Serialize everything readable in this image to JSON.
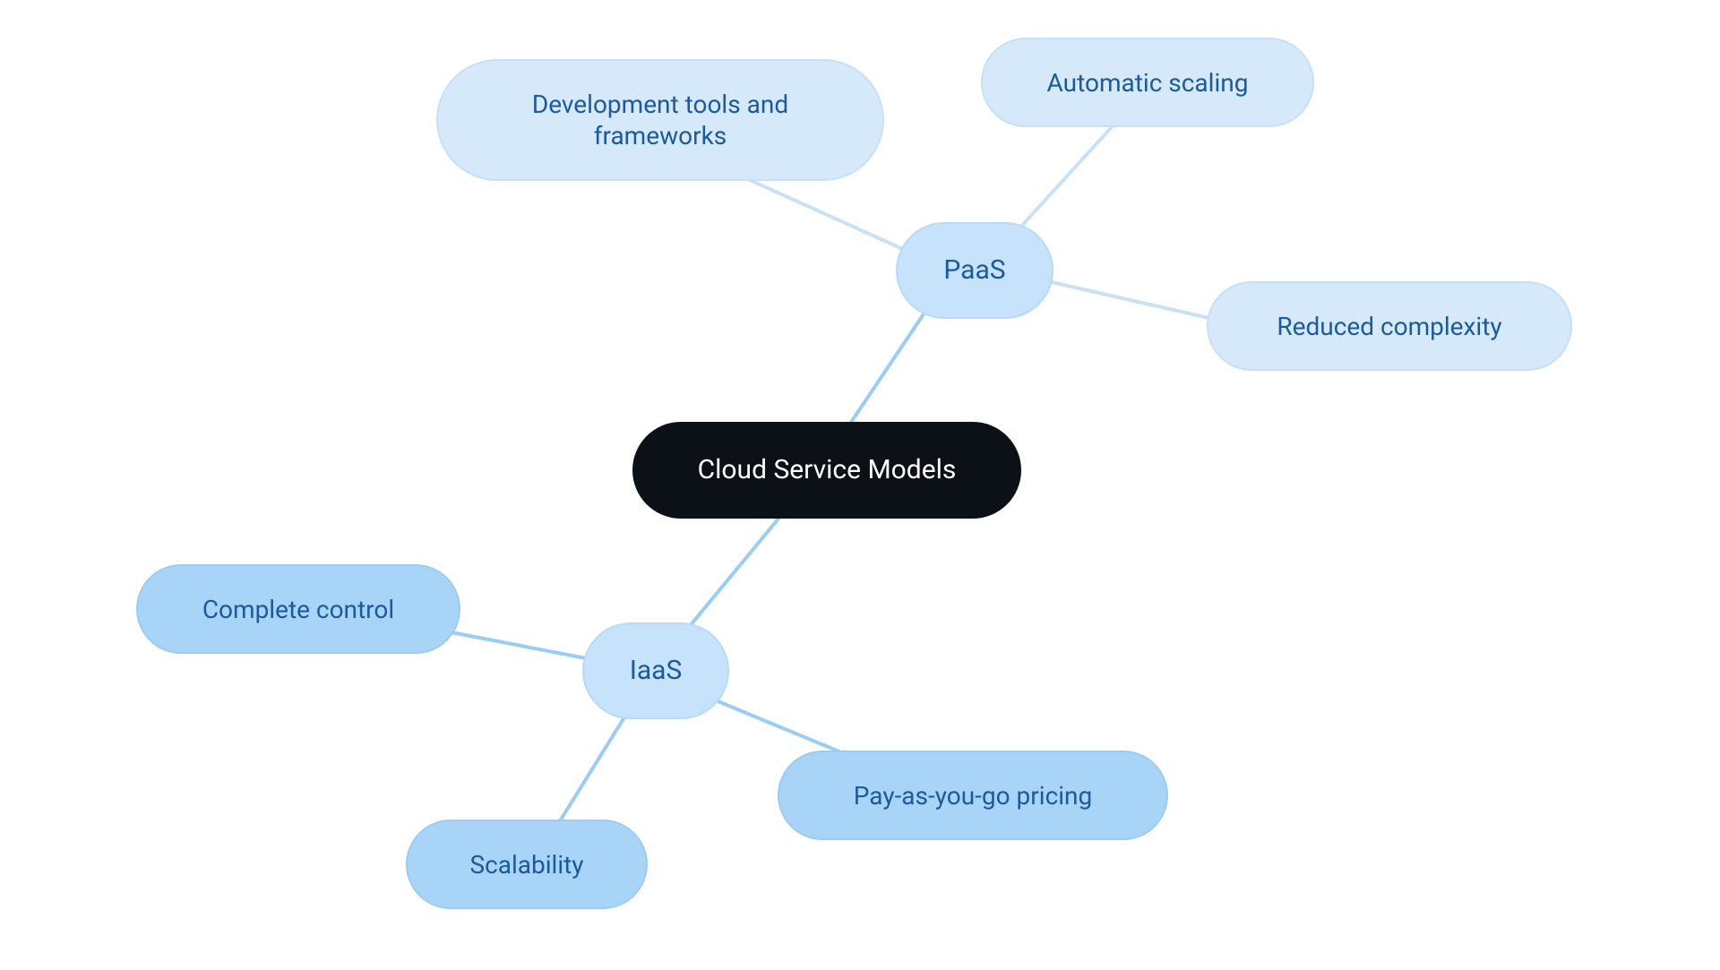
{
  "root": {
    "label": "Cloud Service Models"
  },
  "branches": {
    "paas": {
      "label": "PaaS",
      "leaves": {
        "devtools": "Development tools and frameworks",
        "autoscaling": "Automatic scaling",
        "reduced": "Reduced complexity"
      }
    },
    "iaas": {
      "label": "IaaS",
      "leaves": {
        "control": "Complete control",
        "scalability": "Scalability",
        "payg": "Pay-as-you-go pricing"
      }
    }
  },
  "colors": {
    "edge_dark": "#9acdf3",
    "edge_light": "#c8e1f7"
  }
}
